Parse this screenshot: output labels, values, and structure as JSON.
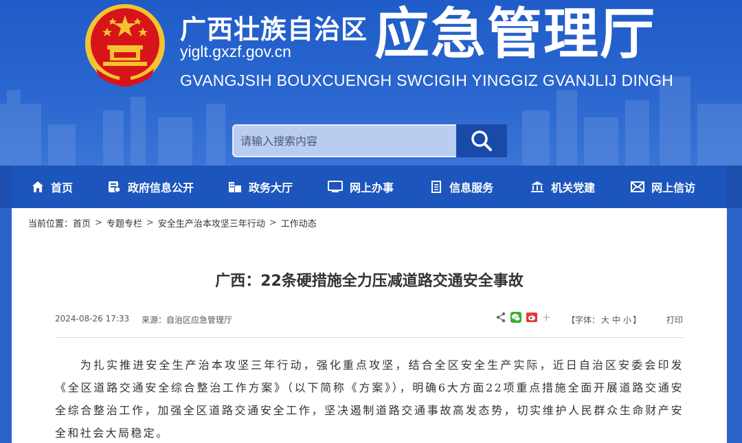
{
  "header": {
    "site_name_cn": "广西壮族自治区",
    "domain": "yiglt.gxzf.gov.cn",
    "dept_name": "应急管理厅",
    "site_name_en": "GVANGJSIH BOUXCUENGH SWCIGIH YINGGIZ GVANJLIJ DINGH",
    "emblem_icon": "national-emblem-icon"
  },
  "search": {
    "placeholder": "请输入搜索内容",
    "button_icon": "search-icon"
  },
  "nav": {
    "items": [
      {
        "label": "首页",
        "icon": "home-icon"
      },
      {
        "label": "政府信息公开",
        "icon": "info-disclosure-icon"
      },
      {
        "label": "政务大厅",
        "icon": "hall-icon"
      },
      {
        "label": "网上办事",
        "icon": "monitor-icon"
      },
      {
        "label": "信息服务",
        "icon": "document-icon"
      },
      {
        "label": "机关党建",
        "icon": "building-icon"
      },
      {
        "label": "网上信访",
        "icon": "mail-icon"
      }
    ]
  },
  "breadcrumb": {
    "prefix": "当前位置：",
    "items": [
      "首页",
      "专题专栏",
      "安全生产治本攻坚三年行动",
      "工作动态"
    ],
    "separator": ">"
  },
  "article": {
    "title": "广西：22条硬措施全力压减道路交通安全事故",
    "date": "2024-08-26 17:33",
    "source": "来源：自治区应急管理厅",
    "font_size_label_open": "【字体：",
    "font_large": "大",
    "font_medium": "中",
    "font_small": "小",
    "font_size_label_close": "】",
    "print": "打印",
    "share_icons": [
      "share-icon",
      "wechat-icon",
      "weibo-icon",
      "plus-icon"
    ],
    "body": "为扎实推进安全生产治本攻坚三年行动，强化重点攻坚，结合全区安全生产实际，近日自治区安委会印发《全区道路交通安全综合整治工作方案》（以下简称《方案》），明确6大方面22项重点措施全面开展道路交通安全综合整治工作，加强全区道路交通安全工作，坚决遏制道路交通事故高发态势，切实维护人民群众生命财产安全和社会大局稳定。"
  },
  "colors": {
    "banner_blue": "#1f5cc8",
    "nav_blue": "#1c56bd",
    "search_button": "#1a4aa8",
    "emblem_red": "#d7141a",
    "emblem_gold": "#f4c430"
  }
}
